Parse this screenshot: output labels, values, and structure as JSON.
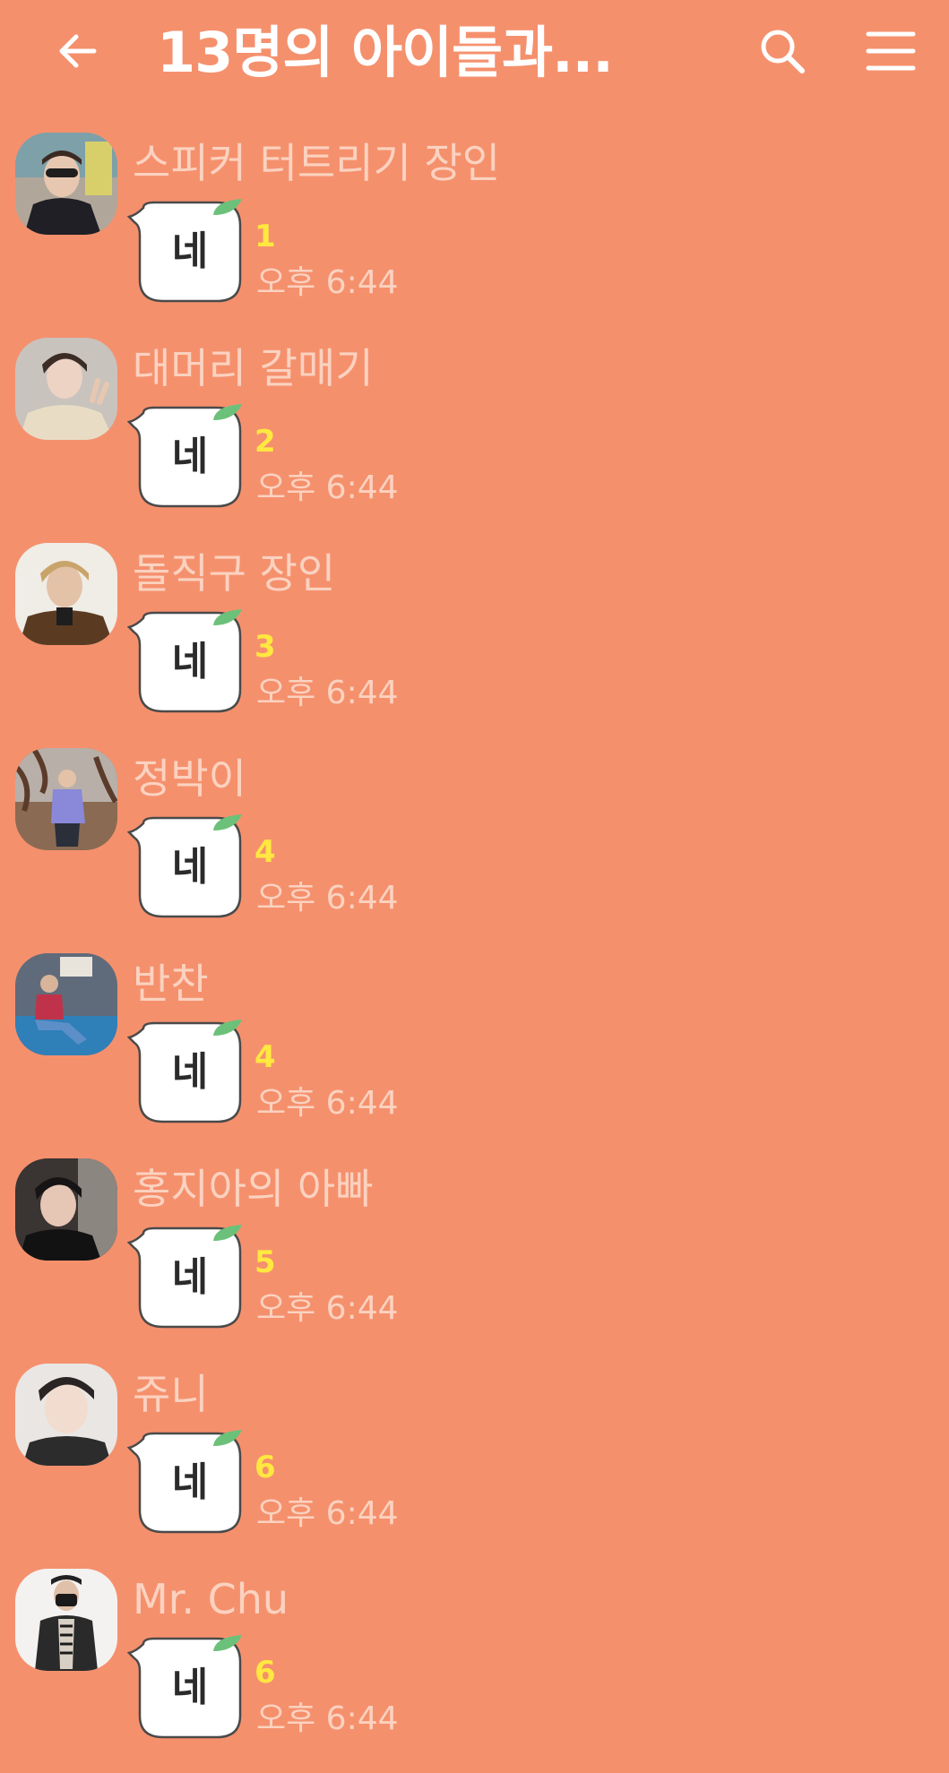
{
  "header": {
    "title": "13명의 아이들과...",
    "back_icon": "arrow-left-icon",
    "search_icon": "search-icon",
    "menu_icon": "hamburger-menu-icon"
  },
  "colors": {
    "background": "#f5906d",
    "bubble": "#ffffff",
    "bubble_leaf": "#6cc17a",
    "sender_text": "#fbd2c0",
    "unread_count": "#ffe840"
  },
  "messages": [
    {
      "sender": "스피커 터트리기 장인",
      "text": "네",
      "unread": "1",
      "time": "오후 6:44"
    },
    {
      "sender": "대머리 갈매기",
      "text": "네",
      "unread": "2",
      "time": "오후 6:44"
    },
    {
      "sender": "돌직구 장인",
      "text": "네",
      "unread": "3",
      "time": "오후 6:44"
    },
    {
      "sender": "정박이",
      "text": "네",
      "unread": "4",
      "time": "오후 6:44"
    },
    {
      "sender": "반찬",
      "text": "네",
      "unread": "4",
      "time": "오후 6:44"
    },
    {
      "sender": "홍지아의 아빠",
      "text": "네",
      "unread": "5",
      "time": "오후 6:44"
    },
    {
      "sender": "쥬니",
      "text": "네",
      "unread": "6",
      "time": "오후 6:44"
    },
    {
      "sender": "Mr. Chu",
      "text": "네",
      "unread": "6",
      "time": "오후 6:44"
    }
  ]
}
